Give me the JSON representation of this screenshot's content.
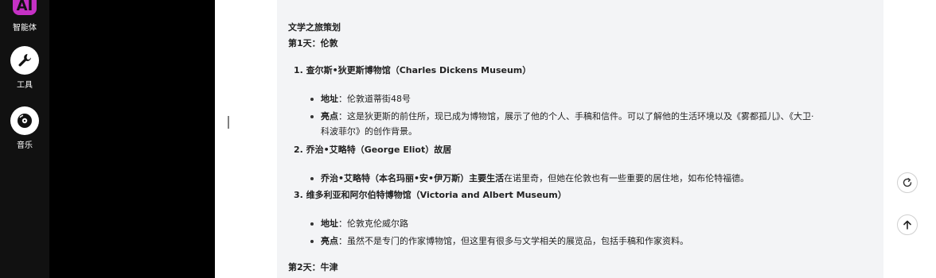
{
  "rail": {
    "items": [
      {
        "label": "智能体",
        "icon": "agent-logo-icon"
      },
      {
        "label": "工具",
        "icon": "wrench-icon"
      },
      {
        "label": "音乐",
        "icon": "music-disc-icon"
      }
    ]
  },
  "colors": {
    "accent": "#c531c5",
    "rail_bg": "#111111",
    "panel_bg": "#000000",
    "content_bg": "#f3f4f6"
  },
  "doc": {
    "title": "文学之旅策划",
    "day1": "第1天：伦敦",
    "items": [
      {
        "heading": "1. 查尔斯•狄更斯博物馆（Charles Dickens Museum）"
      },
      {
        "heading": "2. 乔治•艾略特（George Eliot）故居"
      },
      {
        "heading": "3. 维多利亚和阿尔伯特博物馆（Victoria and Albert Museum）"
      }
    ],
    "item1": {
      "addr_label": "地址",
      "addr_value": "：伦敦道蒂街48号",
      "hl_label": "亮点",
      "hl_value": "：这是狄更斯的前住所，现已成为博物馆，展示了他的个人、手稿和信件。可以了解他的生活环境以及《雾都孤儿》、《大卫·",
      "hl_cont": "科波菲尔》的创作背景。"
    },
    "item2": {
      "bold": "乔治•艾略特（本名玛丽•安•伊万斯）主要生活",
      "rest": "在诺里奇，但她在伦敦也有一些重要的居住地，如布伦特福德。"
    },
    "item3": {
      "addr_label": "地址",
      "addr_value": "：伦敦克伦威尔路",
      "hl_label": "亮点",
      "hl_value": "：虽然不是专门的作家博物馆，但这里有很多与文学相关的展览品，包括手稿和作家资料。"
    },
    "day2": "第2天：牛津"
  },
  "actions": {
    "refresh_icon": "refresh-icon",
    "up_icon": "arrow-up-icon"
  }
}
